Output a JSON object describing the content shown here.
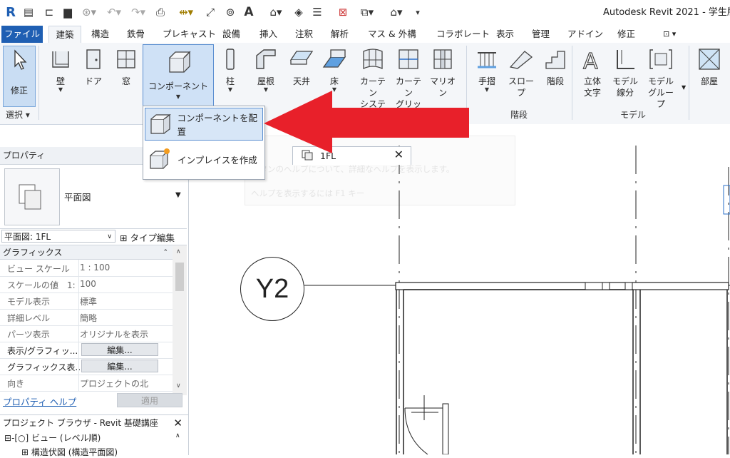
{
  "app": {
    "title": "Autodesk Revit 2021 - 学生版"
  },
  "quick_access": {
    "icons": [
      "revit-logo-icon",
      "home-icon",
      "open-folder-icon",
      "save-icon",
      "sync-icon",
      "undo-icon",
      "redo-icon",
      "print-icon",
      "measure-icon",
      "dimension-icon",
      "tag-icon",
      "text-icon",
      "3d-view-icon",
      "section-icon",
      "thin-lines-icon",
      "close-hidden-icon",
      "switch-windows-icon",
      "user-icon",
      "customize-icon"
    ]
  },
  "menu_tabs": [
    "ファイル",
    "建築",
    "構造",
    "鉄骨",
    "プレキャスト",
    "設備",
    "挿入",
    "注釈",
    "解析",
    "マス & 外構",
    "コラボレート",
    "表示",
    "管理",
    "アドイン",
    "修正"
  ],
  "ribbon": {
    "select": {
      "modify": "修正",
      "panel": "選択"
    },
    "buttons": {
      "wall": "壁",
      "door": "ドア",
      "window": "窓",
      "component": "コンポーネント",
      "column": "柱",
      "roof": "屋根",
      "ceiling": "天井",
      "floor": "床",
      "curtain_system": "カーテン\nシステム",
      "curtain_grid": "カーテン\nグリッド",
      "mullion": "マリオン",
      "railing": "手摺",
      "ramp": "スロープ",
      "stair": "階段",
      "model_text": "立体\n文字",
      "model_line": "モデル\n線分",
      "model_group": "モデル\nグループ",
      "room": "部屋"
    },
    "panels": {
      "circulation": "階段",
      "model": "モデル"
    }
  },
  "component_menu": {
    "place": "コンポーネントを配置",
    "inplace": "インプレイスを作成"
  },
  "properties": {
    "header": "プロパティ",
    "type_name": "平面図",
    "instance_combo": "平面図: 1FL",
    "edit_type": "タイプ編集",
    "group": "グラフィックス",
    "rows": [
      {
        "key": "ビュー スケール",
        "value": "1 : 100"
      },
      {
        "key": "スケールの値　1:",
        "value": "100"
      },
      {
        "key": "モデル表示",
        "value": "標準"
      },
      {
        "key": "詳細レベル",
        "value": "簡略"
      },
      {
        "key": "パーツ表示",
        "value": "オリジナルを表示"
      },
      {
        "key": "表示/グラフィッ...",
        "value": "編集..."
      },
      {
        "key": "グラフィックス表...",
        "value": "編集..."
      },
      {
        "key": "向き",
        "value": "プロジェクトの北"
      }
    ],
    "help": "プロパティ ヘルプ",
    "apply": "適用"
  },
  "project_browser": {
    "header": "プロジェクト ブラウザ - Revit 基礎講座",
    "node1": "ビュー (レベル順)",
    "node2": "構造伏図 (構造平面図)"
  },
  "view_tab": {
    "label": "1FL"
  },
  "tooltip": {
    "line1": "ボタンのヘルプについて、詳細なヘルプを表示します。",
    "line2": "ヘルプを表示するには F1 キー"
  },
  "grid_bubble": {
    "label": "Y2"
  },
  "colors": {
    "accent": "#1f5fb3",
    "arrow": "#e8202a",
    "highlight": "#d7e6f7"
  }
}
